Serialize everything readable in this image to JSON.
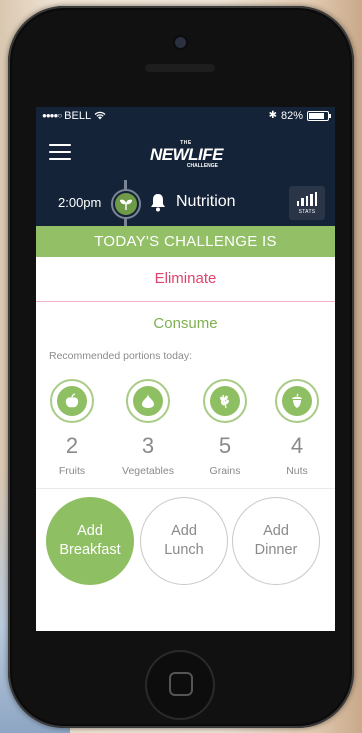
{
  "status_bar": {
    "carrier": "BELL",
    "battery": "82%"
  },
  "logo": {
    "top": "THE",
    "main": "NEWLIFE",
    "sub": "CHALLENGE"
  },
  "nav": {
    "time": "2:00pm",
    "section": "Nutrition",
    "stats_label": "STATS"
  },
  "challenge": {
    "banner": "TODAY'S CHALLENGE IS",
    "eliminate": "Eliminate",
    "consume": "Consume"
  },
  "portions": {
    "label": "Recommended portions today:",
    "items": [
      {
        "name": "Fruits",
        "count": "2",
        "icon": "apple-icon"
      },
      {
        "name": "Vegetables",
        "count": "3",
        "icon": "onion-icon"
      },
      {
        "name": "Grains",
        "count": "5",
        "icon": "wheat-icon"
      },
      {
        "name": "Nuts",
        "count": "4",
        "icon": "acorn-icon"
      }
    ]
  },
  "meals": {
    "breakfast": {
      "line1": "Add",
      "line2": "Breakfast"
    },
    "lunch": {
      "line1": "Add",
      "line2": "Lunch"
    },
    "dinner": {
      "line1": "Add",
      "line2": "Dinner"
    }
  },
  "colors": {
    "header": "#142338",
    "accent_green": "#93bf66",
    "eliminate_red": "#e0436d"
  }
}
